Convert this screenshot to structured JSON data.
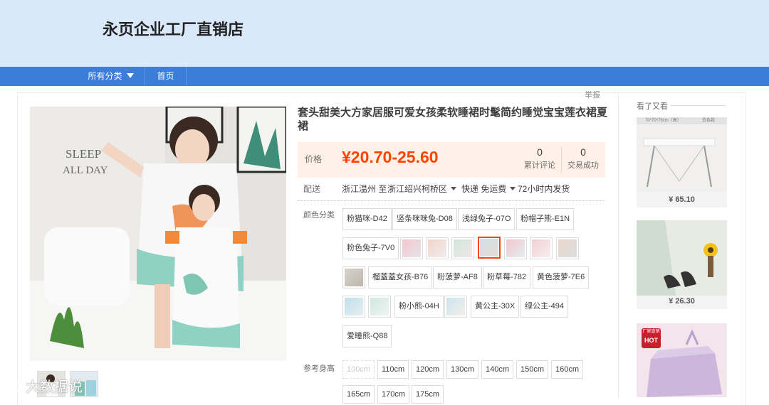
{
  "shop": {
    "name": "永页企业工厂直销店"
  },
  "nav": {
    "categories_label": "所有分类",
    "home_label": "首页"
  },
  "report_label": "举报",
  "product": {
    "title": "套头甜美大方家居服可爱女孩柔软睡裙时髦简约睡觉宝宝莲衣裙夏裙",
    "price_label": "价格",
    "price": "¥20.70-25.60",
    "reviews_count": "0",
    "reviews_label": "累计评论",
    "sales_count": "0",
    "sales_label": "交易成功",
    "shipping": {
      "label": "配送",
      "from_to": "浙江温州 至",
      "destination": "浙江绍兴柯桥区",
      "method": "快递 免运费",
      "dispatch": "72小时内发货"
    },
    "color_label": "颜色分类",
    "colors": [
      "粉猫咪-D42",
      "竖条咪咪兔-D08",
      "浅绿兔子-07O",
      "粉帽子熊-E1N",
      "粉色兔子-7V0",
      "榴蓋蓋女孩-B76",
      "粉菠萝-AF8",
      "粉草莓-782",
      "黄色菠萝-7E6",
      "粉小熊-04H",
      "黄公主-30X",
      "绿公主-494",
      "爱睡熊-Q88"
    ],
    "height_label": "参考身高",
    "heights": [
      "100cm",
      "110cm",
      "120cm",
      "130cm",
      "140cm",
      "150cm",
      "160cm",
      "165cm",
      "170cm",
      "175cm"
    ]
  },
  "sidebar": {
    "title": "看了又看",
    "items": [
      {
        "price": "¥ 65.10",
        "caption": "70*70*75cm（高）",
        "tag": "白色款"
      },
      {
        "price": "¥ 26.30"
      },
      {
        "badge": "厂家直销",
        "badge_hot": "HOT"
      }
    ]
  },
  "image_text": {
    "wall_art": "SLEEP ALL DAY"
  },
  "watermark": "大数据说"
}
